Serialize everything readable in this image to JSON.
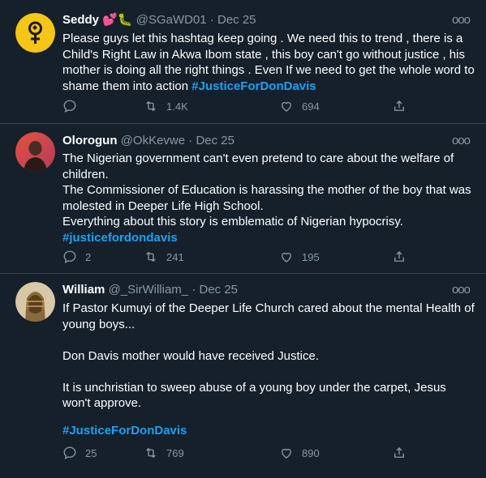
{
  "tweets": [
    {
      "name": "Seddy 💕🐛",
      "handle": "@SGaWD01",
      "date": "Dec 25",
      "text": "Please guys let this hashtag keep going . We need this to trend , there is a Child's Right Law in Akwa Ibom state , this boy can't go without justice , his mother is doing all the right things . Even If we need to get the whole word to shame them into action ",
      "hashtag": "#JusticeForDonDavis",
      "replies": "",
      "retweets": "1.4K",
      "likes": "694"
    },
    {
      "name": "Olorogun",
      "handle": "@OkKevwe",
      "date": "Dec 25",
      "text": "The Nigerian government can't even pretend to care about the welfare of children.\nThe Commissioner of Education is harassing the mother of the boy that was molested in Deeper Life High School.\nEverything about this story is emblematic of Nigerian hypocrisy.\n",
      "hashtag": "#justicefordondavis",
      "replies": "2",
      "retweets": "241",
      "likes": "195"
    },
    {
      "name": "William",
      "handle": "@_SirWilliam_",
      "date": "Dec 25",
      "text": "If Pastor Kumuyi of the Deeper Life Church cared about the mental Health of young boys...\n\nDon Davis mother would have received Justice.\n\nIt is unchristian to sweep abuse of a young boy under the carpet, Jesus won't approve.",
      "hashtag": "#JusticeForDonDavis",
      "replies": "25",
      "retweets": "769",
      "likes": "890"
    }
  ],
  "more_glyph": "ooo",
  "separator": " · ",
  "colors": {
    "background": "#15202b",
    "link": "#1da1f2",
    "muted": "#8899a6",
    "divider": "#38444d"
  }
}
